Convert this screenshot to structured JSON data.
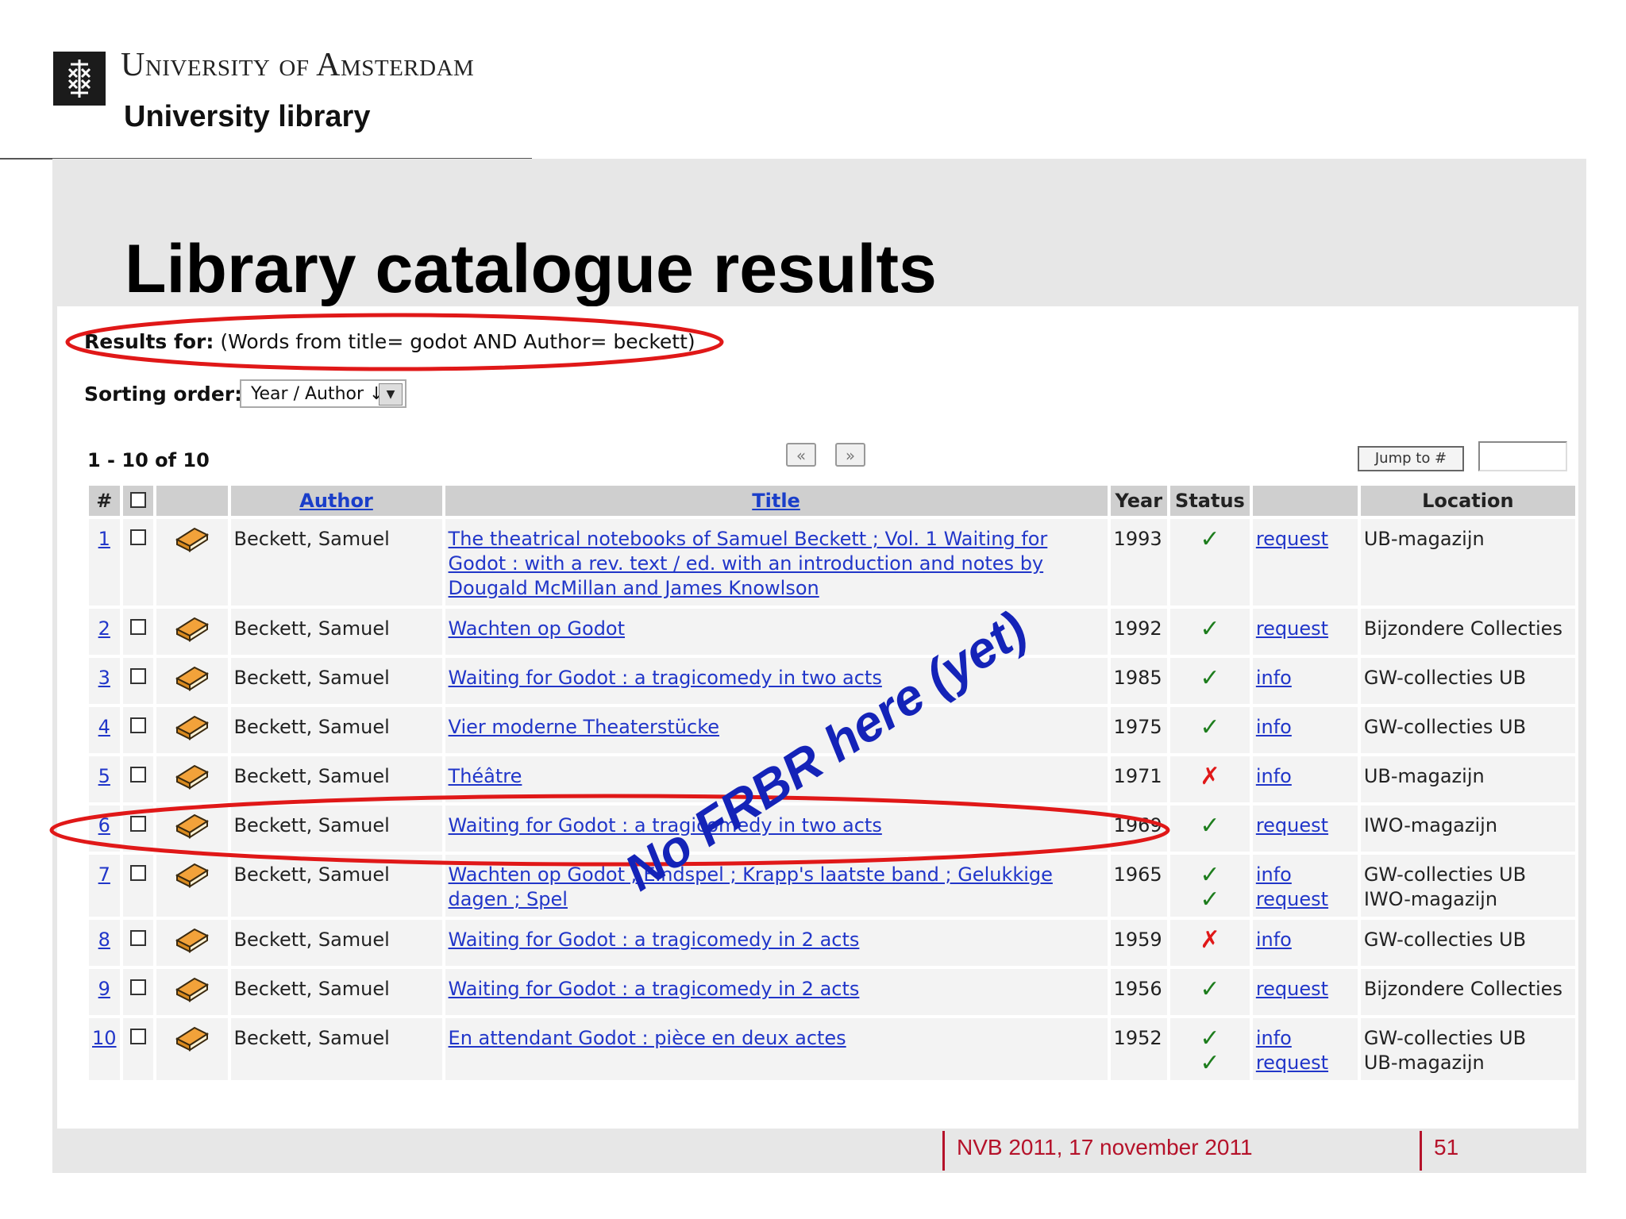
{
  "header": {
    "university_name": "University of Amsterdam",
    "library": "University library"
  },
  "slide": {
    "title": "Library catalogue results",
    "footer_text": "NVB 2011, 17 november 2011",
    "page_number": "51",
    "annotation": "No FRBR here (yet)"
  },
  "search": {
    "results_for_label": "Results for:",
    "query": "(Words from title= godot AND Author= beckett)",
    "sorting_label": "Sorting order:",
    "sorting_value": "Year / Author ↓",
    "count": "1 - 10 of 10",
    "prev_symbol": "«",
    "next_symbol": "»",
    "jump_label": "Jump to #",
    "jump_value": ""
  },
  "table": {
    "headers": {
      "num": "#",
      "author": "Author",
      "title": "Title",
      "year": "Year",
      "status": "Status",
      "location": "Location"
    },
    "rows": [
      {
        "num": "1",
        "author": "Beckett, Samuel",
        "title": "The theatrical notebooks of Samuel Beckett ; Vol. 1 Waiting for Godot : with a rev. text / ed. with an introduction and notes by Dougald McMillan and James Knowlson",
        "year": "1993",
        "status": [
          "ok"
        ],
        "actions": [
          "request"
        ],
        "locations": [
          "UB-magazijn"
        ]
      },
      {
        "num": "2",
        "author": "Beckett, Samuel",
        "title": "Wachten op Godot",
        "year": "1992",
        "status": [
          "ok"
        ],
        "actions": [
          "request"
        ],
        "locations": [
          "Bijzondere Collecties"
        ]
      },
      {
        "num": "3",
        "author": "Beckett, Samuel",
        "title": "Waiting for Godot : a tragicomedy in two acts",
        "year": "1985",
        "status": [
          "ok"
        ],
        "actions": [
          "info"
        ],
        "locations": [
          "GW-collecties UB"
        ]
      },
      {
        "num": "4",
        "author": "Beckett, Samuel",
        "title": "Vier moderne Theaterstücke",
        "year": "1975",
        "status": [
          "ok"
        ],
        "actions": [
          "info"
        ],
        "locations": [
          "GW-collecties UB"
        ]
      },
      {
        "num": "5",
        "author": "Beckett, Samuel",
        "title": "Théâtre",
        "year": "1971",
        "status": [
          "no"
        ],
        "actions": [
          "info"
        ],
        "locations": [
          "UB-magazijn"
        ]
      },
      {
        "num": "6",
        "author": "Beckett, Samuel",
        "title": "Waiting for Godot : a tragicomedy in two acts",
        "year": "1969",
        "status": [
          "ok"
        ],
        "actions": [
          "request"
        ],
        "locations": [
          "IWO-magazijn"
        ]
      },
      {
        "num": "7",
        "author": "Beckett, Samuel",
        "title": "Wachten op Godot ; Eindspel ; Krapp's laatste band ; Gelukkige dagen ; Spel",
        "year": "1965",
        "status": [
          "ok",
          "ok"
        ],
        "actions": [
          "info",
          "request"
        ],
        "locations": [
          "GW-collecties UB",
          "IWO-magazijn"
        ]
      },
      {
        "num": "8",
        "author": "Beckett, Samuel",
        "title": "Waiting for Godot : a tragicomedy in 2 acts",
        "year": "1959",
        "status": [
          "no"
        ],
        "actions": [
          "info"
        ],
        "locations": [
          "GW-collecties UB"
        ]
      },
      {
        "num": "9",
        "author": "Beckett, Samuel",
        "title": "Waiting for Godot : a tragicomedy in 2 acts",
        "year": "1956",
        "status": [
          "ok"
        ],
        "actions": [
          "request"
        ],
        "locations": [
          "Bijzondere Collecties"
        ]
      },
      {
        "num": "10",
        "author": "Beckett, Samuel",
        "title": "En attendant Godot : pièce en deux actes",
        "year": "1952",
        "status": [
          "ok",
          "ok"
        ],
        "actions": [
          "info",
          "request"
        ],
        "locations": [
          "GW-collecties UB",
          "UB-magazijn"
        ]
      }
    ]
  },
  "colors": {
    "link": "#2136c9",
    "annotation": "#1423b8",
    "highlight_ellipse": "#e01818",
    "status_ok": "#1d7d1d",
    "status_unavailable": "#e01818",
    "footer": "#b5122a"
  },
  "icons": {
    "logo": "uva-crest-icon",
    "row_item": "book-icon",
    "status_ok": "checkmark-icon",
    "status_unavailable": "cross-icon"
  }
}
